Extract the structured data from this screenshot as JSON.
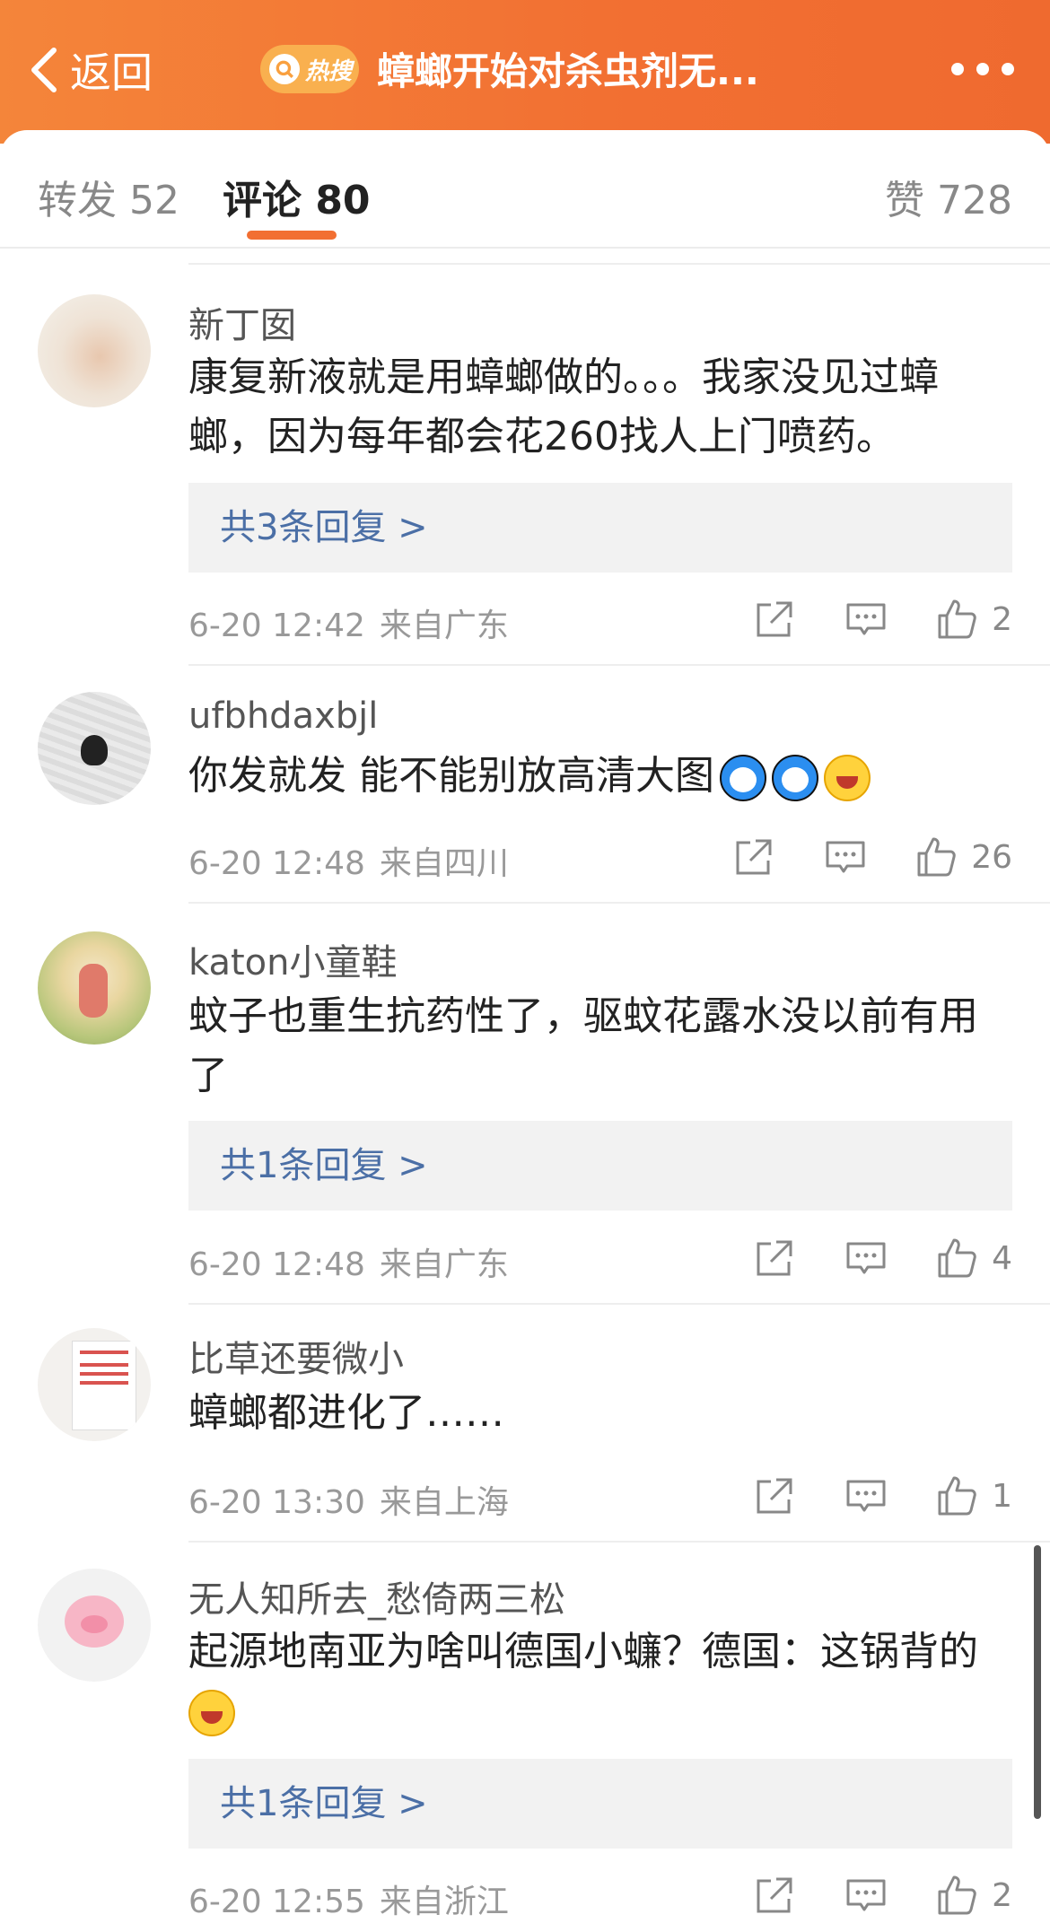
{
  "header": {
    "back_label": "返回",
    "hot_label": "热搜",
    "title": "蟑螂开始对杀虫剂无..."
  },
  "tabs": {
    "forward": "转发 52",
    "comments": "评论 80",
    "likes": "赞 728"
  },
  "colors": {
    "accent": "#f26f32",
    "link": "#4b6fa6"
  },
  "comments": [
    {
      "name": "新丁囡",
      "text": "康复新液就是用蟑螂做的。。。我家没见过蟑螂，因为每年都会花260找人上门喷药。",
      "replies": "共3条回复 >",
      "time": "6-20 12:42",
      "location": "来自广东",
      "likes": "2"
    },
    {
      "name": "ufbhdaxbjl",
      "text": "你发就发 能不能别放高清大图",
      "emojis": [
        "doraemon-emoji",
        "doraemon-emoji",
        "laugh-cry-emoji"
      ],
      "time": "6-20 12:48",
      "location": "来自四川",
      "likes": "26"
    },
    {
      "name": "katon小童鞋",
      "text": "蚊子也重生抗药性了，驱蚊花露水没以前有用了",
      "replies": "共1条回复 >",
      "time": "6-20 12:48",
      "location": "来自广东",
      "likes": "4"
    },
    {
      "name": "比草还要微小",
      "text": "蟑螂都进化了……",
      "time": "6-20 13:30",
      "location": "来自上海",
      "likes": "1"
    },
    {
      "name": "无人知所去_愁倚两三松",
      "text": "起源地南亚为啥叫德国小蠊？德国：这锅背的",
      "emojis": [
        "laugh-cry-emoji"
      ],
      "replies": "共1条回复 >",
      "time": "6-20 12:55",
      "location": "来自浙江",
      "likes": "2"
    }
  ]
}
